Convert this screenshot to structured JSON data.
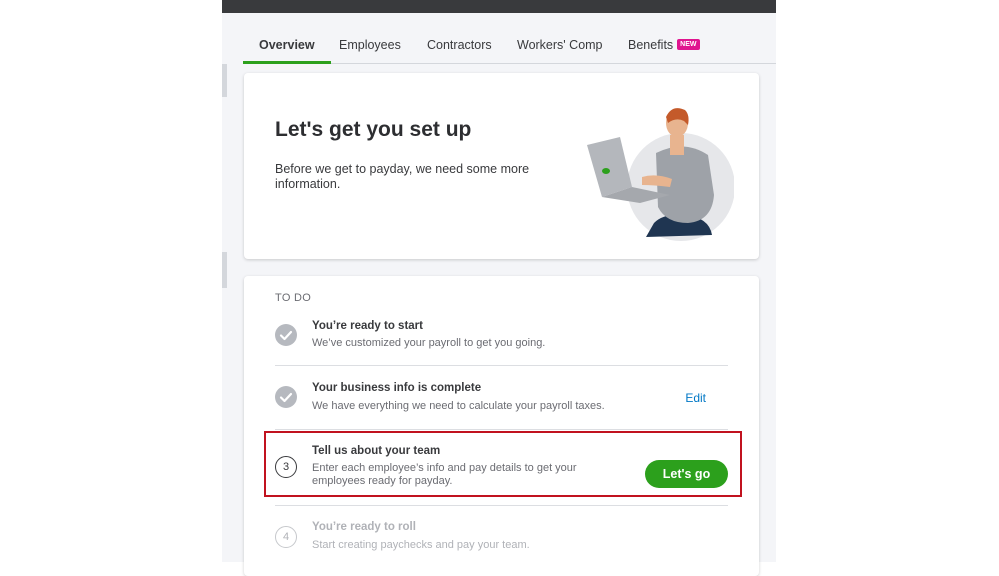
{
  "tabs": [
    {
      "label": "Overview",
      "active": true
    },
    {
      "label": "Employees",
      "active": false
    },
    {
      "label": "Contractors",
      "active": false
    },
    {
      "label": "Workers' Comp",
      "active": false
    },
    {
      "label": "Benefits",
      "active": false,
      "badge": "NEW"
    }
  ],
  "hero": {
    "title": "Let's get you set up",
    "subtitle": "Before we get to payday, we need some more information."
  },
  "todo": {
    "header": "TO DO",
    "items": [
      {
        "title": "You’re ready to start",
        "desc": "We’ve customized your payroll to get you going.",
        "status": "done"
      },
      {
        "title": "Your business info is complete",
        "desc": "We have everything we need to calculate your payroll taxes.",
        "status": "done",
        "action": "Edit"
      },
      {
        "title": "Tell us about your team",
        "desc": "Enter each employee’s info and pay details to get your employees ready for payday.",
        "status": "current",
        "step": "3",
        "action": "Let's go"
      },
      {
        "title": "You’re ready to roll",
        "desc": "Start creating paychecks and pay your team.",
        "status": "pending",
        "step": "4"
      }
    ]
  },
  "colors": {
    "accent_green": "#2ca01c",
    "link_blue": "#0077c5",
    "highlight_red": "#c1121f",
    "badge_pink": "#e0148f"
  }
}
